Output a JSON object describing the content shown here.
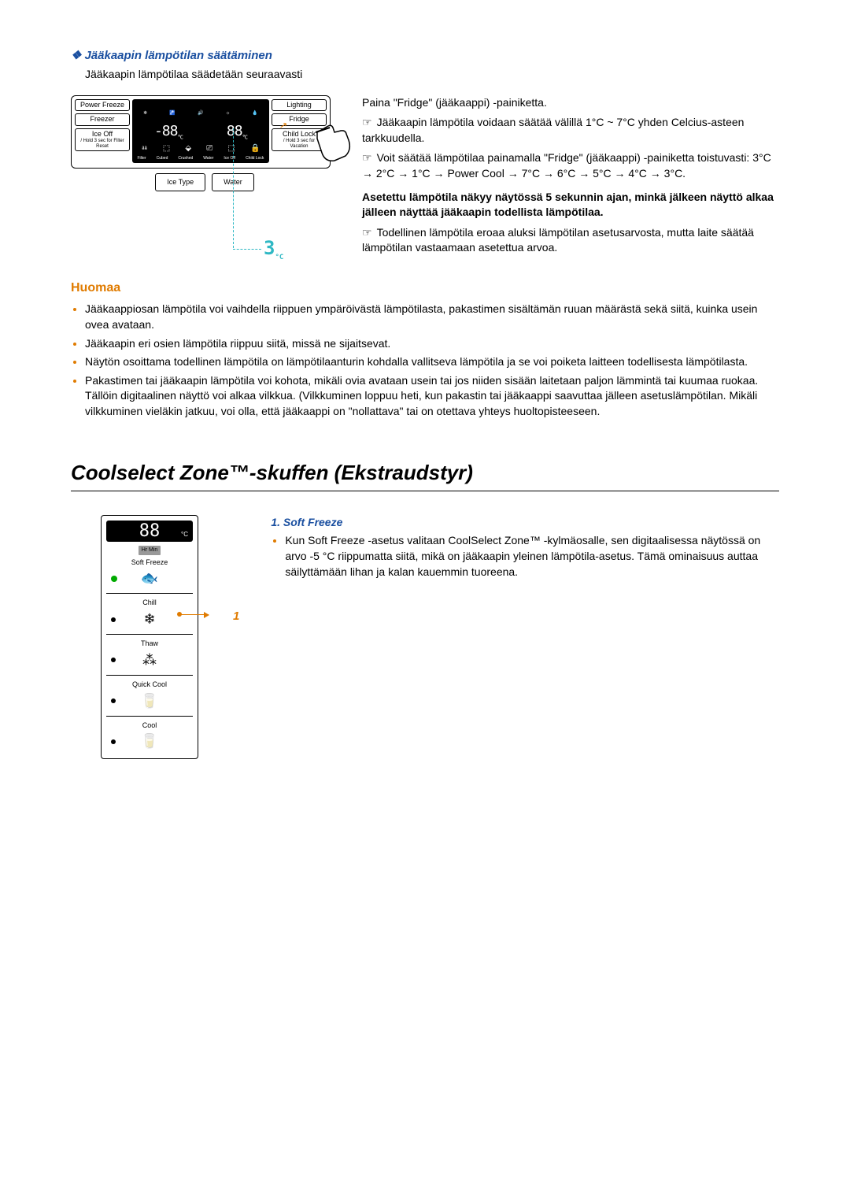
{
  "section1": {
    "heading": "Jääkaapin lämpötilan säätäminen",
    "intro": "Jääkaapin lämpötilaa säädetään seuraavasti",
    "panel": {
      "left": {
        "power_freeze": "Power Freeze",
        "freezer": "Freezer",
        "ice_off": "Ice Off",
        "ice_off_sub": "/ Hold 3 sec\nfor Filter Reset"
      },
      "right": {
        "lighting": "Lighting",
        "fridge": "Fridge",
        "child_lock": "Child Lock",
        "child_lock_sub": "/ Hold 3 sec\nfor Vacation"
      },
      "center": {
        "freezer_temp": "-88",
        "fridge_temp": "88",
        "deg": "°C",
        "icons_labels": [
          "Filter",
          "Cubed",
          "Crushed",
          "Water",
          "Ice Off",
          "Child Lock"
        ]
      },
      "bottom": {
        "ice_type": "Ice Type",
        "water": "Water"
      },
      "arrow_temp": "3",
      "arrow_temp_unit": "°C"
    },
    "r1": "Paina \"Fridge\" (jääkaappi) -painiketta.",
    "r2": "Jääkaapin lämpötila voidaan säätää välillä 1°C ~ 7°C yhden Celcius-asteen tarkkuudella.",
    "r3": "Voit säätää lämpötilaa painamalla \"Fridge\" (jääkaappi) -painiketta toistuvasti: 3°C → 2°C → 1°C → Power Cool → 7°C → 6°C → 5°C → 4°C → 3°C.",
    "r4_bold": "Asetettu lämpötila näkyy näytössä 5 sekunnin ajan, minkä jälkeen näyttö alkaa jälleen näyttää jääkaapin todellista lämpötilaa.",
    "r5": "Todellinen lämpötila eroaa aluksi lämpötilan asetusarvosta, mutta laite säätää lämpötilan vastaamaan asetettua arvoa."
  },
  "huomaa": {
    "heading": "Huomaa",
    "b1": "Jääkaappiosan lämpötila voi vaihdella riippuen ympäröivästä lämpötilasta, pakastimen sisältämän ruuan määrästä sekä siitä, kuinka usein ovea avataan.",
    "b2": "Jääkaapin eri osien lämpötila riippuu siitä, missä ne sijaitsevat.",
    "b3": "Näytön osoittama todellinen lämpötila on lämpötilaanturin kohdalla vallitseva lämpötila ja se voi poiketa laitteen todellisesta lämpötilasta.",
    "b4": "Pakastimen tai jääkaapin lämpötila voi kohota, mikäli ovia avataan usein tai jos niiden sisään laitetaan paljon lämmintä tai kuumaa ruokaa. Tällöin digitaalinen näyttö voi alkaa vilkkua. (Vilkkuminen loppuu heti, kun pakastin tai jääkaappi saavuttaa jälleen asetuslämpötilan. Mikäli vilkkuminen vieläkin jatkuu, voi olla, että jääkaappi on \"nollattava\" tai on otettava yhteys huoltopisteeseen."
  },
  "section2": {
    "heading": "Coolselect Zone™-skuffen (Ekstraudstyr)",
    "soft_heading": "1. Soft Freeze",
    "soft_text": "Kun Soft Freeze -asetus valitaan CoolSelect Zone™ -kylmäosalle, sen digitaalisessa näytössä on arvo -5 °C riippumatta siitä, mikä on jääkaapin yleinen lämpötila-asetus. Tämä ominaisuus auttaa säilyttämään lihan ja kalan kauemmin tuoreena.",
    "callout": "1",
    "panel": {
      "display_temp": "88",
      "display_unit": "°C",
      "hr_min": "Hr   Min",
      "items": [
        "Soft Freeze",
        "Chill",
        "Thaw",
        "Quick Cool",
        "Cool"
      ]
    }
  }
}
